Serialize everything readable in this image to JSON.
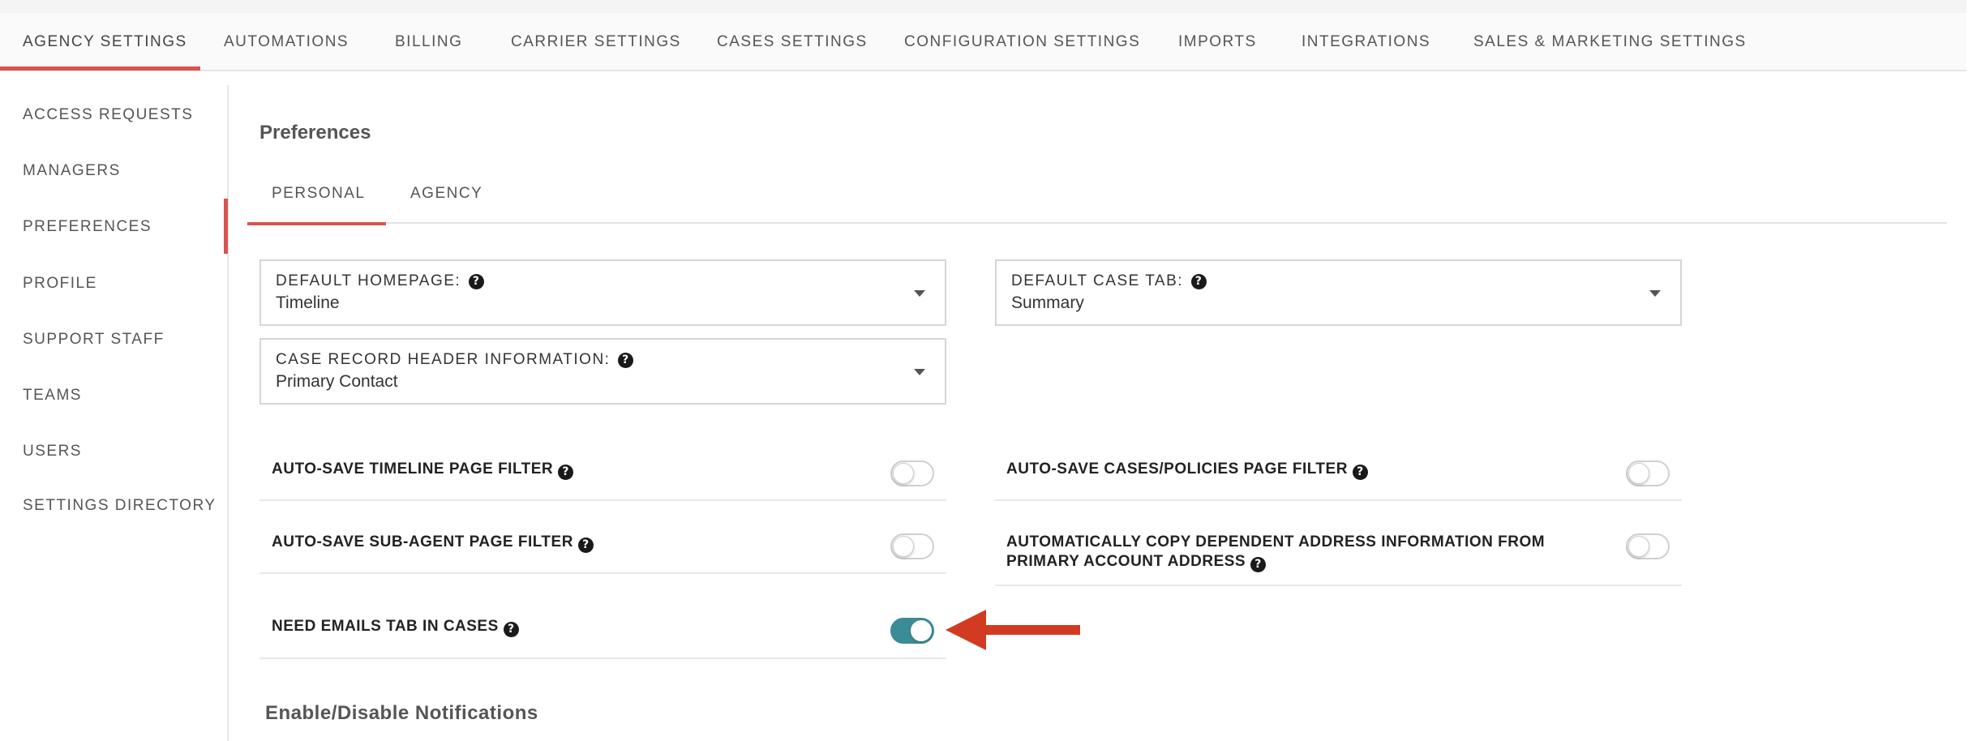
{
  "top_nav": {
    "tabs": [
      {
        "label": "AGENCY SETTINGS",
        "active": true
      },
      {
        "label": "AUTOMATIONS"
      },
      {
        "label": "BILLING"
      },
      {
        "label": "CARRIER SETTINGS"
      },
      {
        "label": "CASES SETTINGS"
      },
      {
        "label": "CONFIGURATION SETTINGS"
      },
      {
        "label": "IMPORTS"
      },
      {
        "label": "INTEGRATIONS"
      },
      {
        "label": "SALES & MARKETING SETTINGS"
      }
    ]
  },
  "sidebar": {
    "items": [
      {
        "label": "ACCESS REQUESTS"
      },
      {
        "label": "MANAGERS"
      },
      {
        "label": "PREFERENCES",
        "active": true
      },
      {
        "label": "PROFILE"
      },
      {
        "label": "SUPPORT STAFF"
      },
      {
        "label": "TEAMS"
      },
      {
        "label": "USERS"
      },
      {
        "label": "SETTINGS DIRECTORY"
      }
    ]
  },
  "main": {
    "title": "Preferences",
    "subtabs": [
      {
        "label": "PERSONAL",
        "active": true
      },
      {
        "label": "AGENCY"
      }
    ],
    "selects": {
      "default_homepage": {
        "label": "DEFAULT HOMEPAGE:",
        "value": "Timeline"
      },
      "default_case_tab": {
        "label": "DEFAULT CASE TAB:",
        "value": "Summary"
      },
      "case_record_header": {
        "label": "CASE RECORD HEADER INFORMATION:",
        "value": "Primary Contact"
      }
    },
    "toggles": {
      "auto_save_timeline": {
        "label": "AUTO-SAVE TIMELINE PAGE FILTER",
        "on": false
      },
      "auto_save_cases": {
        "label": "AUTO-SAVE CASES/POLICIES PAGE FILTER",
        "on": false
      },
      "auto_save_subagent": {
        "label": "AUTO-SAVE SUB-AGENT PAGE FILTER",
        "on": false
      },
      "auto_copy_address": {
        "label_line1": "AUTOMATICALLY COPY DEPENDENT ADDRESS INFORMATION FROM",
        "label_line2": "PRIMARY ACCOUNT ADDRESS",
        "on": false
      },
      "need_emails_tab": {
        "label": "NEED EMAILS TAB IN CASES",
        "on": true
      }
    },
    "notifications_title": "Enable/Disable Notifications"
  },
  "colors": {
    "accent": "#d9534f",
    "toggle_on": "#3a8c97",
    "arrow": "#d13b22"
  },
  "icons": {
    "help": "question-circle-icon",
    "caret": "caret-down-icon",
    "arrow": "left-arrow-icon"
  }
}
